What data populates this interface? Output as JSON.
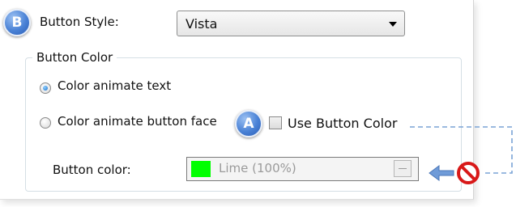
{
  "badges": {
    "b": "B",
    "a": "A"
  },
  "button_style": {
    "label": "Button Style:",
    "value": "Vista"
  },
  "group": {
    "title": "Button Color"
  },
  "options": {
    "animate_text": "Color animate text",
    "animate_face": "Color animate button face"
  },
  "use_button_color": {
    "label": "Use Button Color"
  },
  "button_color": {
    "label": "Button color:",
    "value": "Lime (100%)",
    "swatch": "#00ff00"
  },
  "icons": {
    "dropdown": "chevron-down-icon",
    "disabled": "no-entry-icon",
    "arrow": "arrow-left-icon"
  }
}
